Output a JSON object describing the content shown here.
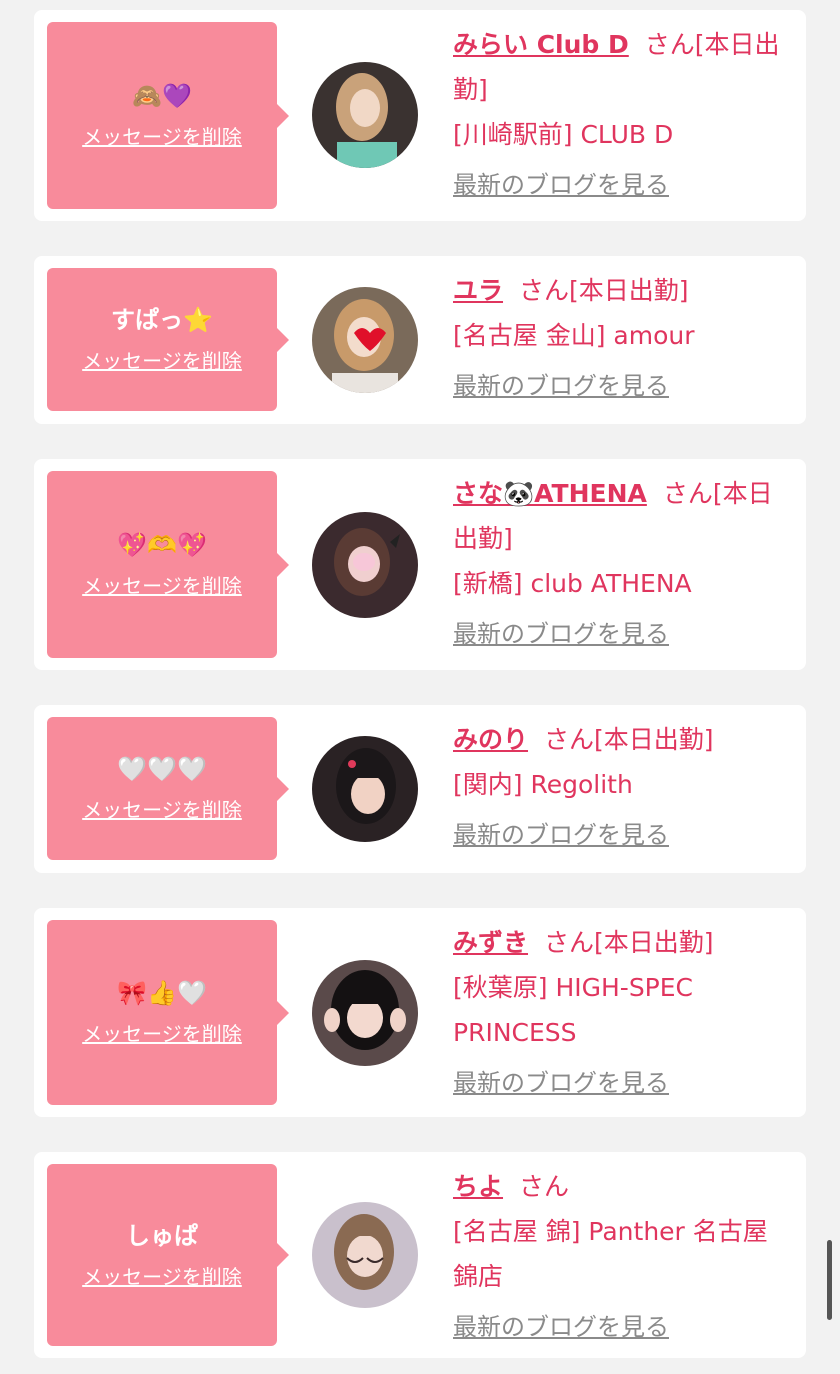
{
  "common": {
    "delete_label": "メッセージを削除",
    "blog_label": "最新のブログを見る",
    "san_label": "さん"
  },
  "items": [
    {
      "message": "🙈💜",
      "name": "みらい Club D",
      "status": "[本日出勤]",
      "shop": "[川崎駅前] CLUB D"
    },
    {
      "message": "すぱっ⭐",
      "name": "ユラ",
      "status": "[本日出勤]",
      "shop": "[名古屋 金山] amour"
    },
    {
      "message": "💖🫶💖",
      "name": "さな🐼ATHENA",
      "status": "[本日出勤]",
      "shop": "[新橋] club ATHENA"
    },
    {
      "message": "🤍🤍🤍",
      "name": "みのり",
      "status": "[本日出勤]",
      "shop": "[関内] Regolith"
    },
    {
      "message": "🎀👍🤍",
      "name": "みずき",
      "status": "[本日出勤]",
      "shop": "[秋葉原] HIGH-SPEC PRINCESS"
    },
    {
      "message": "しゅぱ",
      "name": "ちよ",
      "status": "",
      "shop": "[名古屋 錦] Panther 名古屋錦店"
    }
  ]
}
